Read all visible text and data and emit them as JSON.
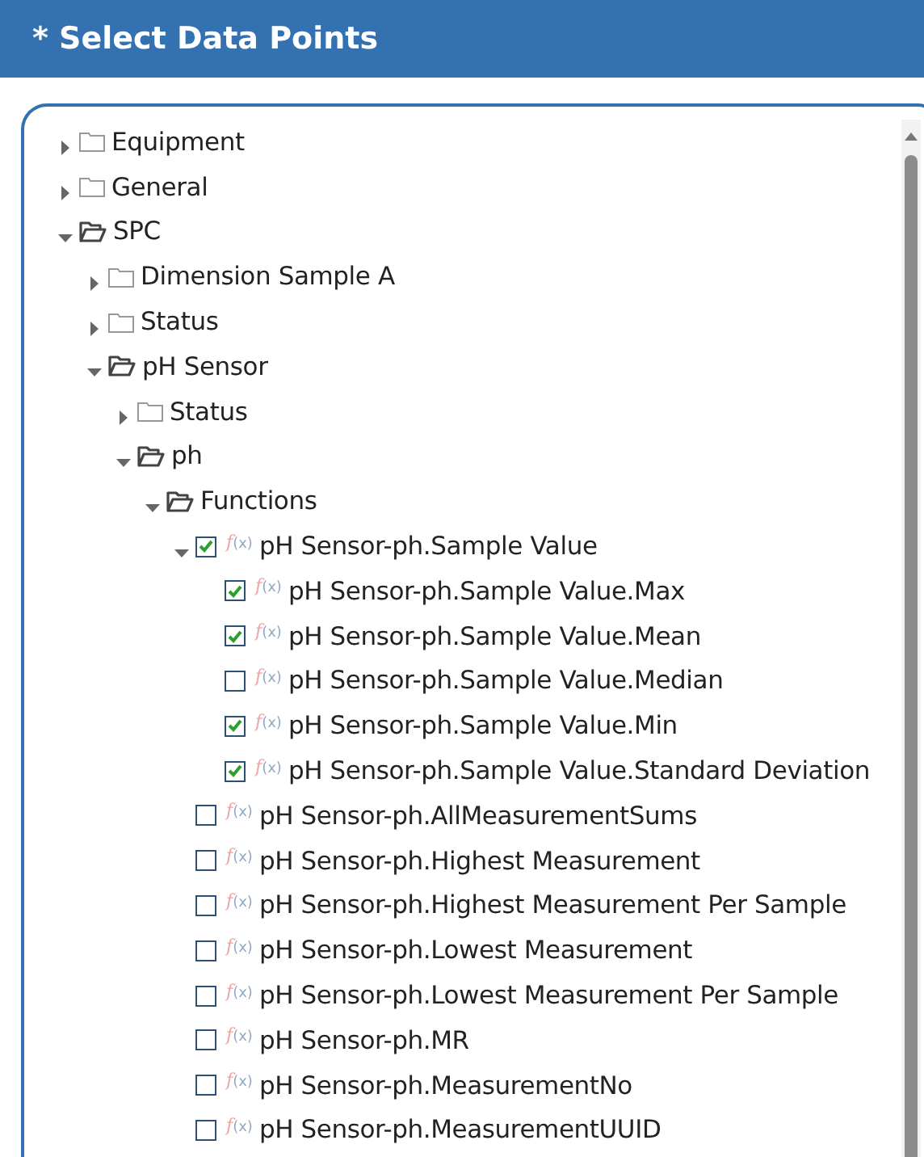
{
  "header": {
    "title": "* Select Data Points"
  },
  "tree": [
    {
      "kind": "folder",
      "label": "Equipment",
      "expanded": false
    },
    {
      "kind": "folder",
      "label": "General",
      "expanded": false
    },
    {
      "kind": "folder",
      "label": "SPC",
      "expanded": true,
      "children": [
        {
          "kind": "folder",
          "label": "Dimension Sample A",
          "expanded": false
        },
        {
          "kind": "folder",
          "label": "Status",
          "expanded": false
        },
        {
          "kind": "folder",
          "label": "pH Sensor",
          "expanded": true,
          "children": [
            {
              "kind": "folder",
              "label": "Status",
              "expanded": false
            },
            {
              "kind": "folder",
              "label": "ph",
              "expanded": true,
              "children": [
                {
                  "kind": "folder",
                  "label": "Functions",
                  "expanded": true,
                  "children": [
                    {
                      "kind": "function",
                      "badge": "f(x)",
                      "label": "pH Sensor-ph.Sample Value",
                      "checked": true,
                      "expanded": true,
                      "children": [
                        {
                          "kind": "function",
                          "badge": "f(x)",
                          "label": "pH Sensor-ph.Sample Value.Max",
                          "checked": true
                        },
                        {
                          "kind": "function",
                          "badge": "f(x)",
                          "label": "pH Sensor-ph.Sample Value.Mean",
                          "checked": true
                        },
                        {
                          "kind": "function",
                          "badge": "f(x)",
                          "label": "pH Sensor-ph.Sample Value.Median",
                          "checked": false
                        },
                        {
                          "kind": "function",
                          "badge": "f(x)",
                          "label": "pH Sensor-ph.Sample Value.Min",
                          "checked": true
                        },
                        {
                          "kind": "function",
                          "badge": "f(x)",
                          "label": "pH Sensor-ph.Sample Value.Standard Deviation",
                          "checked": true
                        }
                      ]
                    },
                    {
                      "kind": "function",
                      "badge": "f(x)",
                      "label": "pH Sensor-ph.AllMeasurementSums",
                      "checked": false
                    },
                    {
                      "kind": "function",
                      "badge": "f(x)",
                      "label": "pH Sensor-ph.Highest Measurement",
                      "checked": false
                    },
                    {
                      "kind": "function",
                      "badge": "f(x)",
                      "label": "pH Sensor-ph.Highest Measurement Per Sample",
                      "checked": false
                    },
                    {
                      "kind": "function",
                      "badge": "f(x)",
                      "label": "pH Sensor-ph.Lowest Measurement",
                      "checked": false
                    },
                    {
                      "kind": "function",
                      "badge": "f(x)",
                      "label": "pH Sensor-ph.Lowest Measurement Per Sample",
                      "checked": false
                    },
                    {
                      "kind": "function",
                      "badge": "f(x)",
                      "label": "pH Sensor-ph.MR",
                      "checked": false
                    },
                    {
                      "kind": "function",
                      "badge": "f(x)",
                      "label": "pH Sensor-ph.MeasurementNo",
                      "checked": false
                    },
                    {
                      "kind": "function",
                      "badge": "f(x)",
                      "label": "pH Sensor-ph.MeasurementUUID",
                      "checked": false
                    }
                  ]
                }
              ]
            }
          ]
        }
      ]
    }
  ]
}
